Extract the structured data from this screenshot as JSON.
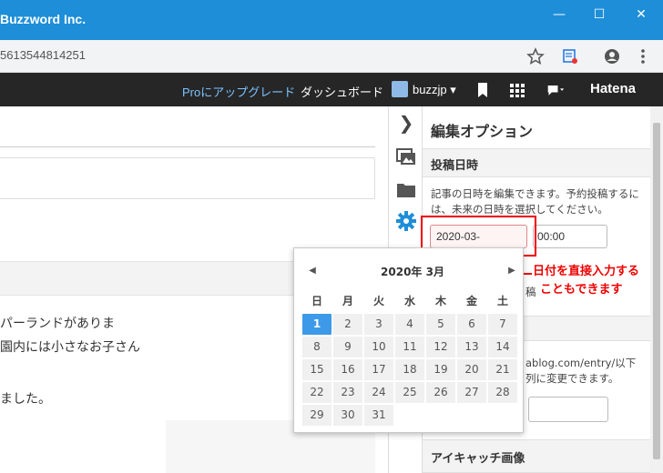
{
  "window": {
    "title": "Buzzword Inc.",
    "minimize_glyph": "—",
    "maximize_glyph": "☐",
    "close_glyph": "✕"
  },
  "browser": {
    "url_fragment": "5613544814251"
  },
  "topbar": {
    "pro_upgrade": "Proにアップグレード",
    "dashboard": "ダッシュボード",
    "username": "buzzjp ▾",
    "logo": "Hatena",
    "accent_color": "#7bc3ff"
  },
  "editor": {
    "text_lines": [
      "パーランドがありま",
      "園内には小さなお子さん",
      "ました。"
    ]
  },
  "panel": {
    "title": "編集オプション",
    "chevron": "❯",
    "date_section_title": "投稿日時",
    "date_description": "記事の日時を編集できます。予約投稿するには、未来の日時を選択してください。",
    "date_value": "2020-03-",
    "time_value": "00:00",
    "hidden_fragment": "稿",
    "url_fragment_1": "ablog.com/entry/以下",
    "url_fragment_2": "列に変更できます。",
    "eyecatch_title": "アイキャッチ画像"
  },
  "annotation": {
    "text_line1": "日付を直接入力する",
    "text_line2": "こともできます",
    "color": "#e00000"
  },
  "datepicker": {
    "prev": "◀",
    "next": "▶",
    "title": "2020年  3月",
    "weekdays": [
      "日",
      "月",
      "火",
      "水",
      "木",
      "金",
      "土"
    ],
    "weeks": [
      [
        "1",
        "2",
        "3",
        "4",
        "5",
        "6",
        "7"
      ],
      [
        "8",
        "9",
        "10",
        "11",
        "12",
        "13",
        "14"
      ],
      [
        "15",
        "16",
        "17",
        "18",
        "19",
        "20",
        "21"
      ],
      [
        "22",
        "23",
        "24",
        "25",
        "26",
        "27",
        "28"
      ],
      [
        "29",
        "30",
        "31",
        "",
        "",
        "",
        ""
      ]
    ],
    "selected": "1",
    "selected_color": "#3d9ae8"
  }
}
